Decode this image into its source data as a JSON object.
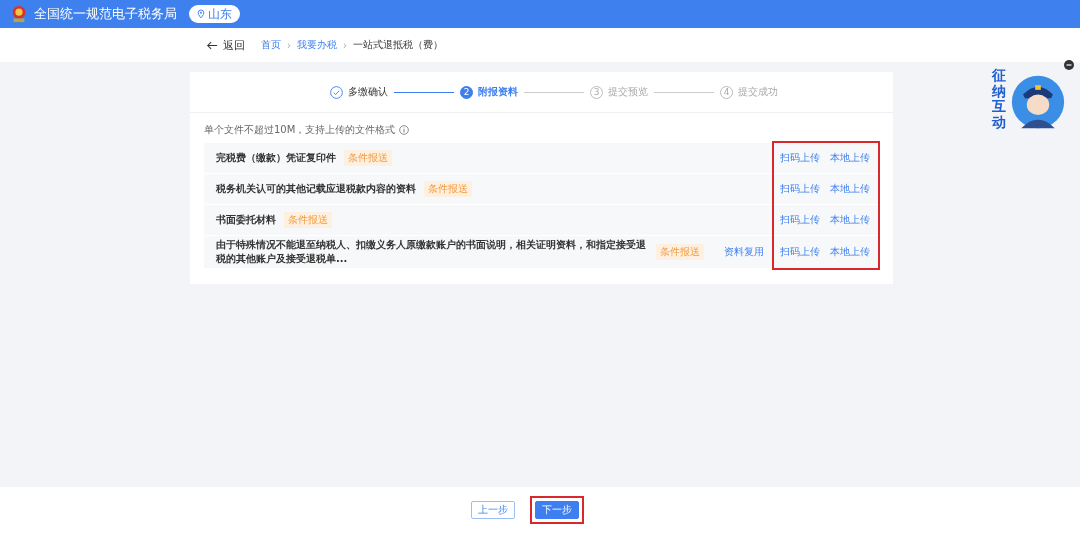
{
  "header": {
    "title": "全国统一规范电子税务局",
    "region": "山东"
  },
  "nav": {
    "back": "返回",
    "separator": "›",
    "breadcrumb": [
      {
        "label": "首页",
        "link": true
      },
      {
        "label": "我要办税",
        "link": true
      },
      {
        "label": "一站式退抵税（费）",
        "link": false
      }
    ]
  },
  "steps": [
    {
      "label": "多缴确认",
      "done": true,
      "selected": false
    },
    {
      "number": "2",
      "label": "附报资料",
      "done": false,
      "selected": true
    },
    {
      "number": "3",
      "label": "提交预览",
      "done": false,
      "selected": false
    },
    {
      "number": "4",
      "label": "提交成功",
      "done": false,
      "selected": false
    }
  ],
  "hint": "单个文件不超过10M，支持上传的文件格式",
  "upload_highlighted": true,
  "materials": [
    {
      "name": "完税费（缴款）凭证复印件",
      "tag": "条件报送",
      "scan": "扫码上传",
      "local": "本地上传"
    },
    {
      "name": "税务机关认可的其他记载应退税款内容的资料",
      "tag": "条件报送",
      "scan": "扫码上传",
      "local": "本地上传"
    },
    {
      "name": "书面委托材料",
      "tag": "条件报送",
      "scan": "扫码上传",
      "local": "本地上传"
    },
    {
      "name": "由于特殊情况不能退至纳税人、扣缴义务人原缴款账户的书面说明，相关证明资料，和指定接受退税的其他账户及接受退税单...",
      "tag": "条件报送",
      "reuse": "资料复用",
      "scan": "扫码上传",
      "local": "本地上传"
    }
  ],
  "assistant": {
    "label": "征纳互动"
  },
  "buttons": [
    {
      "label": "上一步",
      "kind": "secondary",
      "highlighted": false
    },
    {
      "label": "下一步",
      "kind": "primary",
      "highlighted": true
    }
  ]
}
